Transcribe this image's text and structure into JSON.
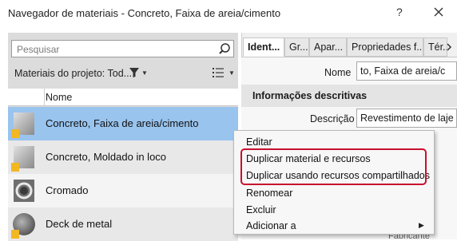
{
  "window": {
    "title": "Navegador de materiais - Concreto, Faixa de areia/cimento",
    "help_glyph": "?"
  },
  "search": {
    "placeholder": "Pesquisar"
  },
  "filter": {
    "label": "Materiais do projeto: Tod..."
  },
  "list": {
    "column_header": "Nome",
    "items": [
      {
        "label": "Concreto, Faixa de areia/cimento",
        "selected": true
      },
      {
        "label": "Concreto, Moldado in loco",
        "selected": false
      },
      {
        "label": "Cromado",
        "selected": false
      },
      {
        "label": "Deck de metal",
        "selected": false
      }
    ]
  },
  "tabs": [
    {
      "label": "Ident...",
      "active": true
    },
    {
      "label": "Gr..."
    },
    {
      "label": "Apar..."
    },
    {
      "label": "Propriedades f..."
    },
    {
      "label": "Tér..."
    }
  ],
  "identity": {
    "name_label": "Nome",
    "name_value": "to, Faixa de areia/c",
    "section_title": "Informações descritivas",
    "description_label": "Descrição",
    "description_value": "Revestimento de laje"
  },
  "partial_text": "Fabricante",
  "context_menu": {
    "items": [
      {
        "label": "Editar"
      },
      {
        "label": "Duplicar material e recursos",
        "highlighted": true
      },
      {
        "label": "Duplicar usando recursos compartilhados",
        "highlighted": true
      },
      {
        "label": "Renomear"
      },
      {
        "label": "Excluir"
      },
      {
        "label": "Adicionar a",
        "submenu": true
      }
    ]
  },
  "colors": {
    "selection": "#99c4ee",
    "highlight_box": "#c8102e"
  },
  "icons": [
    "help-icon",
    "close-icon",
    "search-icon",
    "funnel-icon",
    "list-view-icon",
    "dropdown-icon",
    "submenu-arrow-icon"
  ]
}
